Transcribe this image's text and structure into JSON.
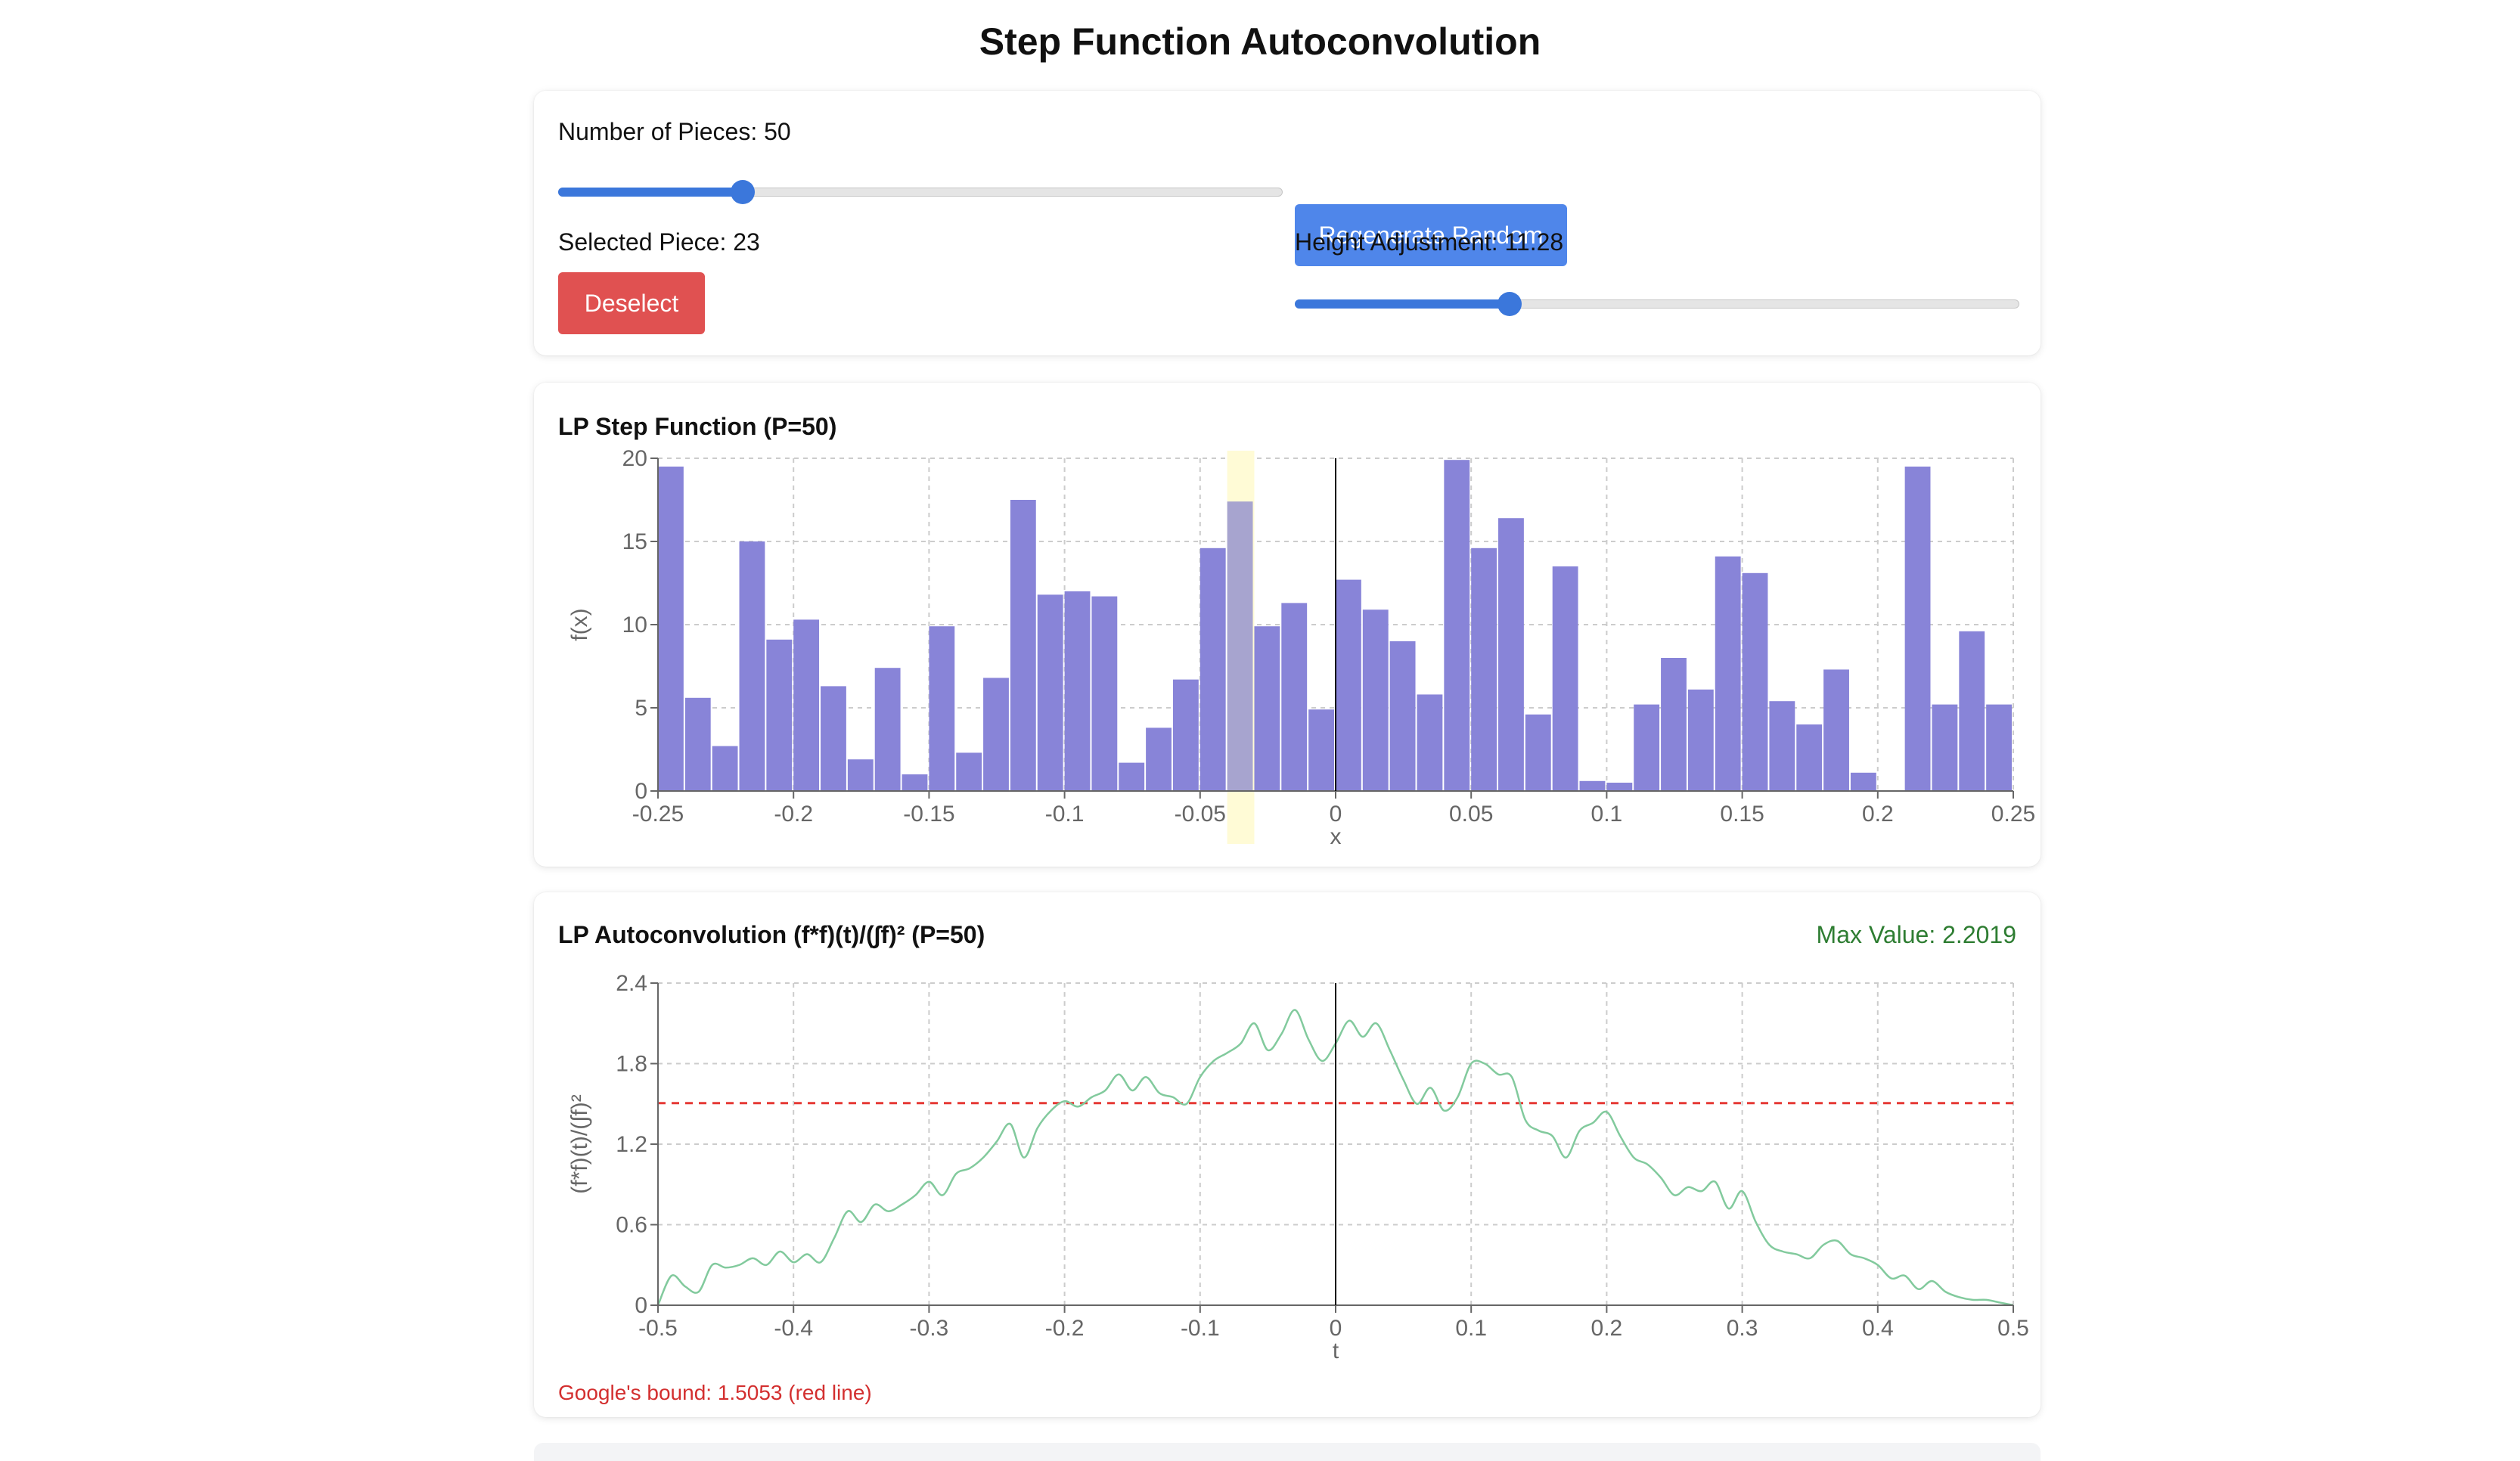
{
  "title": "Step Function Autoconvolution",
  "controls": {
    "pieces_label": "Number of Pieces: 50",
    "pieces_value": 50,
    "pieces_min": 1,
    "pieces_max": 200,
    "regenerate_label": "Regenerate Random",
    "selected_label": "Selected Piece: 23",
    "selected_piece": 23,
    "deselect_label": "Deselect",
    "height_label": "Height Adjustment: 11.28",
    "height_value": 11.28,
    "height_min": 0,
    "height_max": 39
  },
  "step_panel": {
    "title": "LP Step Function (P=50)"
  },
  "autoconv_panel": {
    "title": "LP Autoconvolution (f*f)(t)/(∫f)² (P=50)",
    "max_value": "Max Value: 2.2019",
    "bound_note": "Google's bound: 1.5053 (red line)"
  },
  "colors": {
    "bar": "#8884d8",
    "highlight": "#fffbd6",
    "line": "#82ca9d",
    "bound": "#e53935",
    "slider": "#3b77db",
    "regenerate": "#4f86ea",
    "deselect": "#e05151",
    "max_value": "#2e7d32"
  },
  "chart_data": [
    {
      "type": "bar",
      "title": "LP Step Function (P=50)",
      "xlabel": "x",
      "ylabel": "f(x)",
      "xlim": [
        -0.25,
        0.25
      ],
      "ylim": [
        0,
        20
      ],
      "xticks": [
        -0.25,
        -0.2,
        -0.15,
        -0.1,
        -0.05,
        0,
        0.05,
        0.1,
        0.15,
        0.2,
        0.25
      ],
      "xtick_labels": [
        "-0.25",
        "-0.2",
        "-0.15",
        "-0.1",
        "-0.05",
        "0",
        "0.05",
        "0.1",
        "0.15",
        "0.2",
        "0.25"
      ],
      "yticks": [
        0,
        5,
        10,
        15,
        20
      ],
      "ytick_labels": [
        "0",
        "5",
        "10",
        "15",
        "20"
      ],
      "grid": true,
      "selected_index": 21,
      "values": [
        19.5,
        5.6,
        2.7,
        15.0,
        9.1,
        10.3,
        6.3,
        1.9,
        7.4,
        1.0,
        9.9,
        2.3,
        6.8,
        17.5,
        11.8,
        12.0,
        11.7,
        1.7,
        3.8,
        6.7,
        14.6,
        17.4,
        9.9,
        11.3,
        4.9,
        12.7,
        10.9,
        9.0,
        5.8,
        19.9,
        14.6,
        16.4,
        4.6,
        13.5,
        0.6,
        0.5,
        5.2,
        8.0,
        6.1,
        14.1,
        13.1,
        5.4,
        4.0,
        7.3,
        1.1,
        0.0,
        19.5,
        5.2,
        9.6,
        5.2
      ]
    },
    {
      "type": "line",
      "title": "LP Autoconvolution (f*f)(t)/(∫f)² (P=50)",
      "xlabel": "t",
      "ylabel": "(f*f)(t)/(∫f)²",
      "xlim": [
        -0.5,
        0.5
      ],
      "ylim": [
        0,
        2.4
      ],
      "xticks": [
        -0.5,
        -0.4,
        -0.3,
        -0.2,
        -0.1,
        0,
        0.1,
        0.2,
        0.3,
        0.4,
        0.5
      ],
      "xtick_labels": [
        "-0.5",
        "-0.4",
        "-0.3",
        "-0.2",
        "-0.1",
        "0",
        "0.1",
        "0.2",
        "0.3",
        "0.4",
        "0.5"
      ],
      "yticks": [
        0,
        0.6,
        1.2,
        1.8,
        2.4
      ],
      "ytick_labels": [
        "0",
        "0.6",
        "1.2",
        "1.8",
        "2.4"
      ],
      "grid": true,
      "reference_line": {
        "y": 1.5053
      },
      "max_value": 2.2019,
      "x": [
        -0.5,
        -0.49,
        -0.48,
        -0.47,
        -0.46,
        -0.45,
        -0.44,
        -0.43,
        -0.42,
        -0.41,
        -0.4,
        -0.39,
        -0.38,
        -0.37,
        -0.36,
        -0.35,
        -0.34,
        -0.33,
        -0.32,
        -0.31,
        -0.3,
        -0.29,
        -0.28,
        -0.27,
        -0.26,
        -0.25,
        -0.24,
        -0.23,
        -0.22,
        -0.21,
        -0.2,
        -0.19,
        -0.18,
        -0.17,
        -0.16,
        -0.15,
        -0.14,
        -0.13,
        -0.12,
        -0.11,
        -0.1,
        -0.09,
        -0.08,
        -0.07,
        -0.06,
        -0.05,
        -0.04,
        -0.03,
        -0.02,
        -0.01,
        0,
        0.01,
        0.02,
        0.03,
        0.04,
        0.05,
        0.06,
        0.07,
        0.08,
        0.09,
        0.1,
        0.11,
        0.12,
        0.13,
        0.14,
        0.15,
        0.16,
        0.17,
        0.18,
        0.19,
        0.2,
        0.21,
        0.22,
        0.23,
        0.24,
        0.25,
        0.26,
        0.27,
        0.28,
        0.29,
        0.3,
        0.31,
        0.32,
        0.33,
        0.34,
        0.35,
        0.36,
        0.37,
        0.38,
        0.39,
        0.4,
        0.41,
        0.42,
        0.43,
        0.44,
        0.45,
        0.46,
        0.47,
        0.48,
        0.49,
        0.5
      ],
      "y": [
        0.0,
        0.22,
        0.14,
        0.1,
        0.3,
        0.28,
        0.3,
        0.35,
        0.3,
        0.4,
        0.32,
        0.38,
        0.32,
        0.5,
        0.7,
        0.62,
        0.75,
        0.7,
        0.75,
        0.82,
        0.92,
        0.82,
        0.98,
        1.02,
        1.1,
        1.22,
        1.35,
        1.1,
        1.32,
        1.45,
        1.52,
        1.48,
        1.55,
        1.6,
        1.72,
        1.6,
        1.7,
        1.58,
        1.55,
        1.5,
        1.7,
        1.82,
        1.88,
        1.95,
        2.1,
        1.9,
        2.02,
        2.2,
        1.98,
        1.82,
        1.95,
        2.12,
        2.0,
        2.1,
        1.9,
        1.68,
        1.5,
        1.62,
        1.45,
        1.55,
        1.8,
        1.8,
        1.72,
        1.7,
        1.38,
        1.3,
        1.26,
        1.1,
        1.3,
        1.36,
        1.44,
        1.26,
        1.1,
        1.05,
        0.95,
        0.82,
        0.88,
        0.85,
        0.92,
        0.72,
        0.85,
        0.62,
        0.45,
        0.4,
        0.38,
        0.35,
        0.45,
        0.48,
        0.38,
        0.35,
        0.3,
        0.2,
        0.22,
        0.12,
        0.18,
        0.1,
        0.06,
        0.04,
        0.04,
        0.02,
        0.0
      ]
    }
  ]
}
